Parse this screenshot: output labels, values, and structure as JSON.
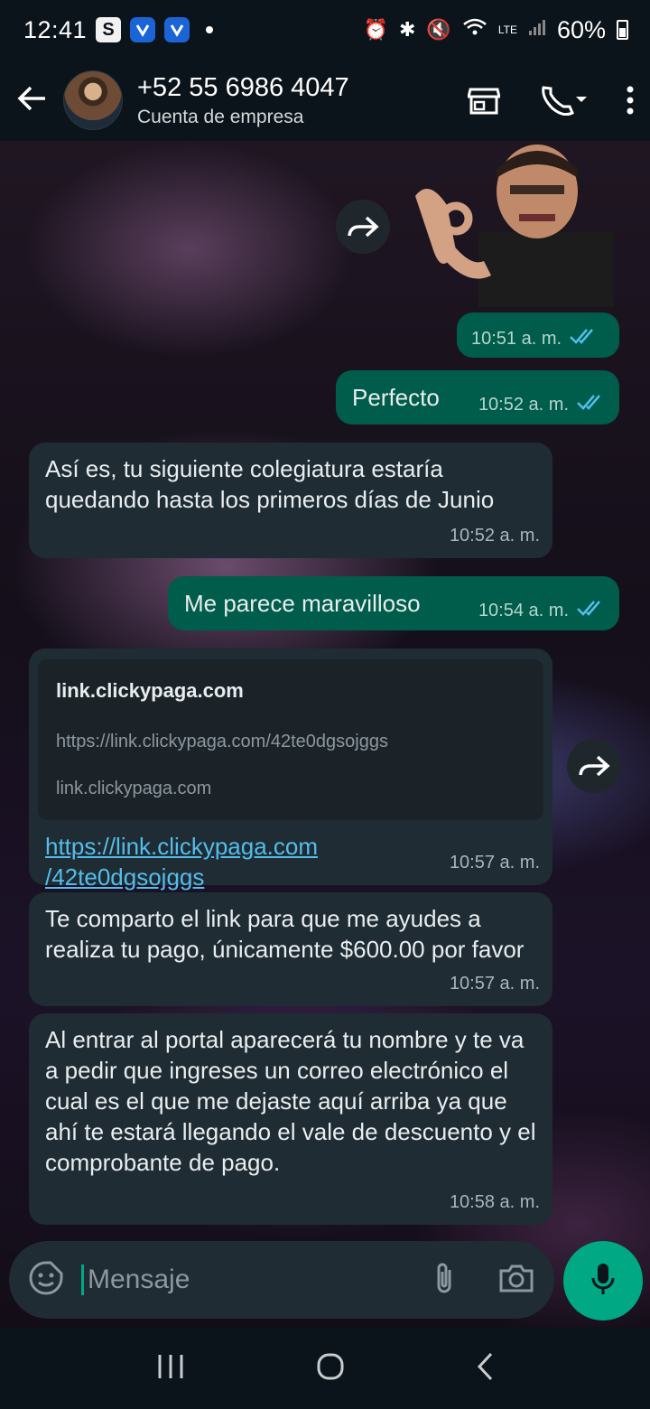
{
  "status_bar": {
    "time": "12:41",
    "badge_s": "S",
    "battery_pct": "60%",
    "network": "LTE"
  },
  "header": {
    "contact_name": "+52 55 6986 4047",
    "contact_sub": "Cuenta de empresa"
  },
  "messages": [
    {
      "type": "sticker",
      "time": "10:51 a. m."
    },
    {
      "type": "outgoing",
      "text": "Perfecto",
      "time": "10:52 a. m."
    },
    {
      "type": "incoming",
      "text": "Así es, tu siguiente colegiatura estaría quedando hasta los primeros días de Junio",
      "time": "10:52 a. m."
    },
    {
      "type": "outgoing",
      "text": "Me parece maravilloso",
      "time": "10:54 a. m."
    },
    {
      "type": "incoming-link",
      "link_title": "link.clickypaga.com",
      "link_url": "https://link.clickypaga.com/42te0dgsojggs",
      "link_domain": "link.clickypaga.com",
      "anchor_line1": "https://link.clickypaga.com",
      "anchor_line2": "/42te0dgsojggs",
      "time": "10:57 a. m."
    },
    {
      "type": "incoming",
      "text": "Te comparto el link para que me ayudes a realiza tu pago, únicamente $600.00 por favor",
      "time": "10:57 a. m."
    },
    {
      "type": "incoming",
      "text": "Al entrar al portal aparecerá tu nombre y te va a pedir que ingreses un correo electrónico el cual es el que me dejaste aquí arriba ya que ahí te estará llegando el vale de descuento y el comprobante de pago.",
      "time": "10:58 a. m."
    }
  ],
  "input": {
    "placeholder": "Mensaje"
  },
  "colors": {
    "outgoing_bubble": "#005c4b",
    "incoming_bubble": "#1f2c34",
    "accent": "#00a884",
    "read_ticks": "#53bdeb"
  }
}
